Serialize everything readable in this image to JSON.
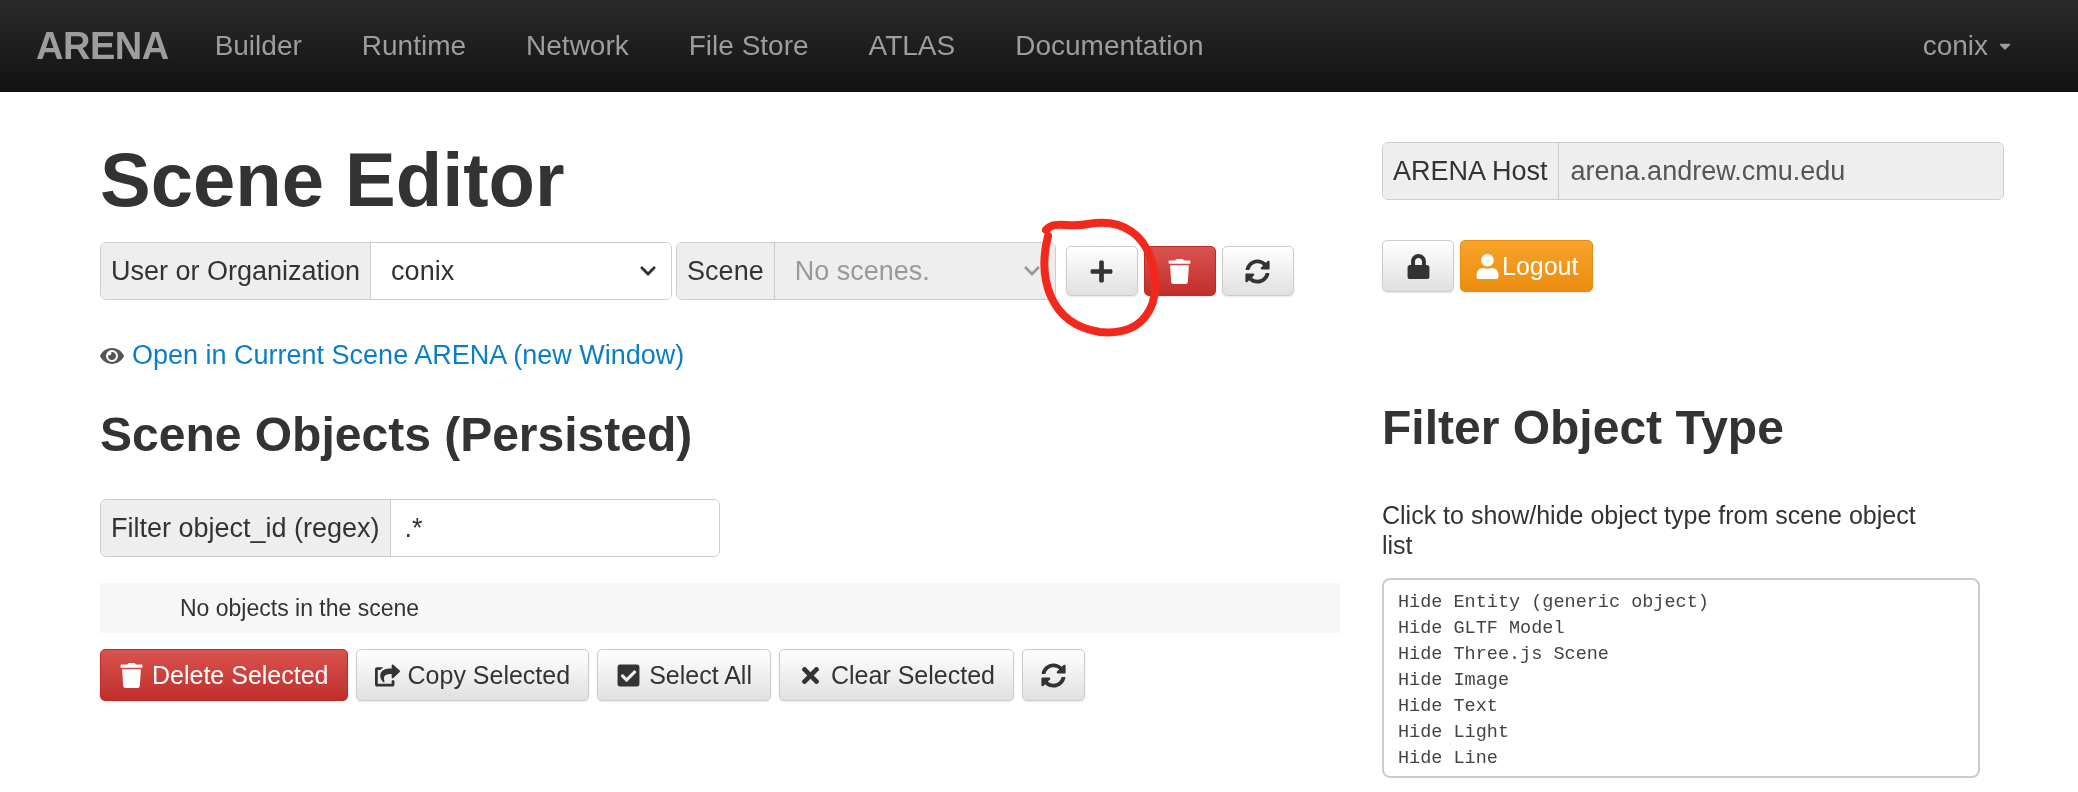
{
  "navbar": {
    "brand": "ARENA",
    "links": [
      {
        "label": "Builder"
      },
      {
        "label": "Runtime"
      },
      {
        "label": "Network"
      },
      {
        "label": "File Store"
      },
      {
        "label": "ATLAS"
      },
      {
        "label": "Documentation"
      }
    ],
    "user": "conix"
  },
  "editor": {
    "title": "Scene Editor",
    "user_select": {
      "label": "User or Organization",
      "value": "conix"
    },
    "scene_select": {
      "label": "Scene",
      "placeholder": "No scenes.",
      "disabled": true
    },
    "scene_buttons": [
      {
        "kind": "add",
        "annotated": true
      },
      {
        "kind": "delete",
        "annotated": false
      },
      {
        "kind": "refresh",
        "annotated": false
      }
    ],
    "open_link": "Open in Current Scene ARENA (new Window)"
  },
  "objects": {
    "title": "Scene Objects (Persisted)",
    "filter": {
      "label": "Filter object_id (regex)",
      "value": ".*"
    },
    "empty_message": "No objects in the scene",
    "buttons": [
      {
        "kind": "delete",
        "label": "Delete Selected"
      },
      {
        "kind": "copy",
        "label": "Copy Selected"
      },
      {
        "kind": "check",
        "label": "Select All"
      },
      {
        "kind": "clear",
        "label": "Clear Selected"
      },
      {
        "kind": "refresh"
      }
    ]
  },
  "host": {
    "label": "ARENA Host",
    "value": "arena.andrew.cmu.edu"
  },
  "account_buttons": [
    {
      "kind": "lock"
    },
    {
      "kind": "user",
      "label": "Logout"
    }
  ],
  "filter_types": {
    "title": "Filter Object Type",
    "description": "Click to show/hide object type from scene object list",
    "items": [
      "Hide Entity (generic object)",
      "Hide GLTF Model",
      "Hide Three.js Scene",
      "Hide Image",
      "Hide Text",
      "Hide Light",
      "Hide Line"
    ]
  }
}
